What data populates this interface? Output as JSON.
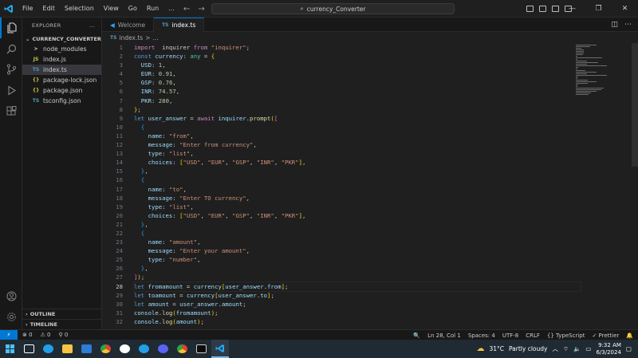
{
  "titlebar": {
    "menu": [
      "File",
      "Edit",
      "Selection",
      "View",
      "Go",
      "Run",
      "..."
    ],
    "search": "currency_Converter"
  },
  "explorer": {
    "header": "EXPLORER",
    "more": "...",
    "folder": "CURRENCY_CONVERTER",
    "files": [
      {
        "name": "node_modules",
        "icon": ">",
        "icon_color": "#cccccc"
      },
      {
        "name": "index.js",
        "icon": "JS",
        "icon_color": "#cbcb41"
      },
      {
        "name": "index.ts",
        "icon": "TS",
        "icon_color": "#519aba"
      },
      {
        "name": "package-lock.json",
        "icon": "{}",
        "icon_color": "#cbcb41"
      },
      {
        "name": "package.json",
        "icon": "{}",
        "icon_color": "#cbcb41"
      },
      {
        "name": "tsconfig.json",
        "icon": "TS",
        "icon_color": "#519aba"
      }
    ],
    "outline": "OUTLINE",
    "timeline": "TIMELINE"
  },
  "tabs": [
    {
      "label": "Welcome",
      "icon": "vscode-icon"
    },
    {
      "label": "index.ts",
      "icon": "TS"
    }
  ],
  "breadcrumb": {
    "icon": "TS",
    "file": "index.ts",
    "sep": ">",
    "more": "..."
  },
  "editor": {
    "current_line": 28,
    "lines": [
      [
        [
          "kwc",
          "import"
        ],
        [
          "",
          "  inquirer "
        ],
        [
          "kwc",
          "from"
        ],
        [
          "",
          " "
        ],
        [
          "str",
          "\"inquirer\""
        ],
        [
          "",
          ";"
        ]
      ],
      [
        [
          "kw",
          "const"
        ],
        [
          "",
          " "
        ],
        [
          "var",
          "currency"
        ],
        [
          "",
          ": "
        ],
        [
          "ty",
          "any"
        ],
        [
          "",
          " = "
        ],
        [
          "br1",
          "{"
        ]
      ],
      [
        [
          "",
          "  "
        ],
        [
          "var",
          "USD"
        ],
        [
          "",
          ": "
        ],
        [
          "num",
          "1"
        ],
        [
          "",
          ","
        ]
      ],
      [
        [
          "",
          "  "
        ],
        [
          "var",
          "EUR"
        ],
        [
          "",
          ": "
        ],
        [
          "num",
          "0.91"
        ],
        [
          "",
          ","
        ]
      ],
      [
        [
          "",
          "  "
        ],
        [
          "var",
          "GSP"
        ],
        [
          "",
          ": "
        ],
        [
          "num",
          "0.76"
        ],
        [
          "",
          ","
        ]
      ],
      [
        [
          "",
          "  "
        ],
        [
          "var",
          "INR"
        ],
        [
          "",
          ": "
        ],
        [
          "num",
          "74.57"
        ],
        [
          "",
          ","
        ]
      ],
      [
        [
          "",
          "  "
        ],
        [
          "var",
          "PKR"
        ],
        [
          "",
          ": "
        ],
        [
          "num",
          "280"
        ],
        [
          "",
          ","
        ]
      ],
      [
        [
          "br1",
          "}"
        ],
        [
          "",
          ";"
        ]
      ],
      [
        [
          "kw",
          "let"
        ],
        [
          "",
          " "
        ],
        [
          "var",
          "user_answer"
        ],
        [
          "",
          " = "
        ],
        [
          "kwc",
          "await"
        ],
        [
          "",
          " "
        ],
        [
          "var",
          "inquirer"
        ],
        [
          "",
          "."
        ],
        [
          "fn",
          "prompt"
        ],
        [
          "br1",
          "("
        ],
        [
          "br2",
          "["
        ]
      ],
      [
        [
          "",
          "  "
        ],
        [
          "br3",
          "{"
        ]
      ],
      [
        [
          "",
          "    "
        ],
        [
          "var",
          "name"
        ],
        [
          "",
          ": "
        ],
        [
          "str",
          "\"from\""
        ],
        [
          "",
          ","
        ]
      ],
      [
        [
          "",
          "    "
        ],
        [
          "var",
          "message"
        ],
        [
          "",
          ": "
        ],
        [
          "str",
          "\"Enter from currency\""
        ],
        [
          "",
          ","
        ]
      ],
      [
        [
          "",
          "    "
        ],
        [
          "var",
          "type"
        ],
        [
          "",
          ": "
        ],
        [
          "str",
          "\"list\""
        ],
        [
          "",
          ","
        ]
      ],
      [
        [
          "",
          "    "
        ],
        [
          "var",
          "choices"
        ],
        [
          "",
          ": "
        ],
        [
          "br1",
          "["
        ],
        [
          "str",
          "\"USD\""
        ],
        [
          "",
          ", "
        ],
        [
          "str",
          "\"EUR\""
        ],
        [
          "",
          ", "
        ],
        [
          "str",
          "\"GSP\""
        ],
        [
          "",
          ", "
        ],
        [
          "str",
          "\"INR\""
        ],
        [
          "",
          ", "
        ],
        [
          "str",
          "\"PKR\""
        ],
        [
          "br1",
          "]"
        ],
        [
          "",
          ","
        ]
      ],
      [
        [
          "",
          "  "
        ],
        [
          "br3",
          "}"
        ],
        [
          "",
          ","
        ]
      ],
      [
        [
          "",
          "  "
        ],
        [
          "br3",
          "{"
        ]
      ],
      [
        [
          "",
          "    "
        ],
        [
          "var",
          "name"
        ],
        [
          "",
          ": "
        ],
        [
          "str",
          "\"to\""
        ],
        [
          "",
          ","
        ]
      ],
      [
        [
          "",
          "    "
        ],
        [
          "var",
          "message"
        ],
        [
          "",
          ": "
        ],
        [
          "str",
          "\"Enter TO currency\""
        ],
        [
          "",
          ","
        ]
      ],
      [
        [
          "",
          "    "
        ],
        [
          "var",
          "type"
        ],
        [
          "",
          ": "
        ],
        [
          "str",
          "\"list\""
        ],
        [
          "",
          ","
        ]
      ],
      [
        [
          "",
          "    "
        ],
        [
          "var",
          "choices"
        ],
        [
          "",
          ": "
        ],
        [
          "br1",
          "["
        ],
        [
          "str",
          "\"USD\""
        ],
        [
          "",
          ", "
        ],
        [
          "str",
          "\"EUR\""
        ],
        [
          "",
          ", "
        ],
        [
          "str",
          "\"GSP\""
        ],
        [
          "",
          ", "
        ],
        [
          "str",
          "\"INR\""
        ],
        [
          "",
          ", "
        ],
        [
          "str",
          "\"PKR\""
        ],
        [
          "br1",
          "]"
        ],
        [
          "",
          ","
        ]
      ],
      [
        [
          "",
          "  "
        ],
        [
          "br3",
          "}"
        ],
        [
          "",
          ","
        ]
      ],
      [
        [
          "",
          "  "
        ],
        [
          "br3",
          "{"
        ]
      ],
      [
        [
          "",
          "    "
        ],
        [
          "var",
          "name"
        ],
        [
          "",
          ": "
        ],
        [
          "str",
          "\"amount\""
        ],
        [
          "",
          ","
        ]
      ],
      [
        [
          "",
          "    "
        ],
        [
          "var",
          "message"
        ],
        [
          "",
          ": "
        ],
        [
          "str",
          "\"Enter your amount\""
        ],
        [
          "",
          ","
        ]
      ],
      [
        [
          "",
          "    "
        ],
        [
          "var",
          "type"
        ],
        [
          "",
          ": "
        ],
        [
          "str",
          "\"number\""
        ],
        [
          "",
          ","
        ]
      ],
      [
        [
          "",
          "  "
        ],
        [
          "br3",
          "}"
        ],
        [
          "",
          ","
        ]
      ],
      [
        [
          "br2",
          "]"
        ],
        [
          "br1",
          ")"
        ],
        [
          "",
          ";"
        ]
      ],
      [
        [
          "kw",
          "let"
        ],
        [
          "",
          " "
        ],
        [
          "var",
          "fromamount"
        ],
        [
          "",
          " = "
        ],
        [
          "var",
          "currency"
        ],
        [
          "br1",
          "["
        ],
        [
          "var",
          "user_answer"
        ],
        [
          "",
          "."
        ],
        [
          "var",
          "from"
        ],
        [
          "br1",
          "]"
        ],
        [
          "",
          ";"
        ]
      ],
      [
        [
          "kw",
          "let"
        ],
        [
          "",
          " "
        ],
        [
          "var",
          "toamount"
        ],
        [
          "",
          " = "
        ],
        [
          "var",
          "currency"
        ],
        [
          "br1",
          "["
        ],
        [
          "var",
          "user_answer"
        ],
        [
          "",
          "."
        ],
        [
          "var",
          "to"
        ],
        [
          "br1",
          "]"
        ],
        [
          "",
          ";"
        ]
      ],
      [
        [
          "kw",
          "let"
        ],
        [
          "",
          " "
        ],
        [
          "var",
          "amount"
        ],
        [
          "",
          " = "
        ],
        [
          "var",
          "user_answer"
        ],
        [
          "",
          "."
        ],
        [
          "var",
          "amount"
        ],
        [
          "",
          ";"
        ]
      ],
      [
        [
          "var",
          "console"
        ],
        [
          "",
          "."
        ],
        [
          "fn",
          "log"
        ],
        [
          "br1",
          "("
        ],
        [
          "var",
          "fromamount"
        ],
        [
          "br1",
          ")"
        ],
        [
          "",
          ";"
        ]
      ],
      [
        [
          "var",
          "console"
        ],
        [
          "",
          "."
        ],
        [
          "fn",
          "log"
        ],
        [
          "br1",
          "("
        ],
        [
          "var",
          "amount"
        ],
        [
          "br1",
          ")"
        ],
        [
          "",
          ";"
        ]
      ]
    ]
  },
  "statusbar": {
    "remote": "⚡",
    "errors": "⊗ 0",
    "warnings": "⚠ 0",
    "ports": "⚲ 0",
    "zoom_icon": "🔍",
    "position": "Ln 28, Col 1",
    "spaces": "Spaces: 4",
    "encoding": "UTF-8",
    "eol": "CRLF",
    "language": "{} TypeScript",
    "prettier": "✓ Prettier",
    "bell": "🔔"
  },
  "taskbar": {
    "weather_temp": "31°C",
    "weather_desc": "Partly cloudy",
    "time": "9:32 AM",
    "date": "6/3/2024",
    "apps": [
      {
        "name": "windows-start-icon",
        "color": "#4cc2ff"
      },
      {
        "name": "task-view-icon",
        "color": "#ffffff"
      },
      {
        "name": "edge-icon",
        "color": "#1fa0e8"
      },
      {
        "name": "file-explorer-icon",
        "color": "#f8c342"
      },
      {
        "name": "store-icon",
        "color": "#2d7cd6"
      },
      {
        "name": "chrome-icon",
        "color": "#e34133"
      },
      {
        "name": "github-icon",
        "color": "#ffffff"
      },
      {
        "name": "edge-dev-icon",
        "color": "#1fa0e8"
      },
      {
        "name": "discord-icon",
        "color": "#5865f2"
      },
      {
        "name": "chrome-alt-icon",
        "color": "#e34133"
      },
      {
        "name": "terminal-icon",
        "color": "#cccccc"
      },
      {
        "name": "vscode-icon",
        "color": "#23a9f2"
      }
    ]
  },
  "colors": {
    "accent": "#0078d4",
    "background": "#1f1f1f"
  }
}
